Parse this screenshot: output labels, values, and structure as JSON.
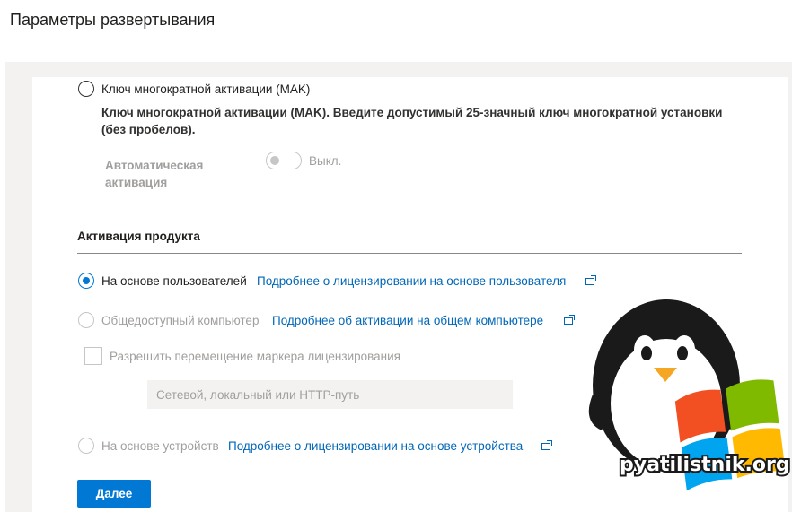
{
  "page": {
    "title": "Параметры развертывания"
  },
  "mak": {
    "radio_label": "Ключ многократной активации (MAK)",
    "description_line1": "Ключ многократной активации (MAK). Введите допустимый 25-значный ключ многократной установки",
    "description_line2": "(без пробелов).",
    "auto_activation_line1": "Автоматическая",
    "auto_activation_line2": "активация",
    "toggle_state": "Выкл."
  },
  "activation": {
    "heading": "Активация продукта",
    "options": [
      {
        "label": "На основе пользователей",
        "link": "Подробнее о лицензировании на основе пользователя",
        "selected": true,
        "enabled": true
      },
      {
        "label": "Общедоступный компьютер",
        "link": "Подробнее об активации на общем компьютере",
        "selected": false,
        "enabled": false
      },
      {
        "label": "На основе устройств",
        "link": "Подробнее о лицензировании на основе устройства",
        "selected": false,
        "enabled": false
      }
    ],
    "roaming_checkbox_label": "Разрешить перемещение маркера лицензирования",
    "path_placeholder": "Сетевой, локальный или HTTP-путь"
  },
  "actions": {
    "next_label": "Далее"
  },
  "watermark": {
    "text": "pyatilistnik.org"
  },
  "colors": {
    "accent": "#0078d4",
    "link": "#0067b8",
    "disabled": "#a19f9d"
  }
}
